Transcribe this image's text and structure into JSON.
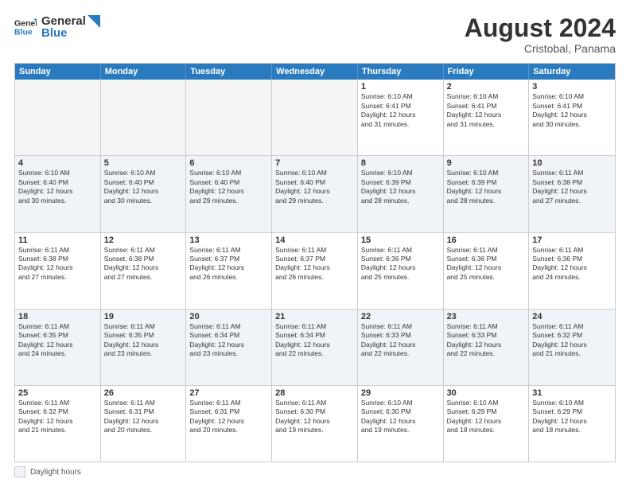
{
  "logo": {
    "general": "General",
    "blue": "Blue"
  },
  "title": "August 2024",
  "subtitle": "Cristobal, Panama",
  "days_of_week": [
    "Sunday",
    "Monday",
    "Tuesday",
    "Wednesday",
    "Thursday",
    "Friday",
    "Saturday"
  ],
  "legend_label": "Daylight hours",
  "weeks": [
    [
      {
        "day": "",
        "info": "",
        "empty": true
      },
      {
        "day": "",
        "info": "",
        "empty": true
      },
      {
        "day": "",
        "info": "",
        "empty": true
      },
      {
        "day": "",
        "info": "",
        "empty": true
      },
      {
        "day": "1",
        "info": "Sunrise: 6:10 AM\nSunset: 6:41 PM\nDaylight: 12 hours\nand 31 minutes.",
        "empty": false
      },
      {
        "day": "2",
        "info": "Sunrise: 6:10 AM\nSunset: 6:41 PM\nDaylight: 12 hours\nand 31 minutes.",
        "empty": false
      },
      {
        "day": "3",
        "info": "Sunrise: 6:10 AM\nSunset: 6:41 PM\nDaylight: 12 hours\nand 30 minutes.",
        "empty": false
      }
    ],
    [
      {
        "day": "4",
        "info": "Sunrise: 6:10 AM\nSunset: 6:40 PM\nDaylight: 12 hours\nand 30 minutes.",
        "empty": false
      },
      {
        "day": "5",
        "info": "Sunrise: 6:10 AM\nSunset: 6:40 PM\nDaylight: 12 hours\nand 30 minutes.",
        "empty": false
      },
      {
        "day": "6",
        "info": "Sunrise: 6:10 AM\nSunset: 6:40 PM\nDaylight: 12 hours\nand 29 minutes.",
        "empty": false
      },
      {
        "day": "7",
        "info": "Sunrise: 6:10 AM\nSunset: 6:40 PM\nDaylight: 12 hours\nand 29 minutes.",
        "empty": false
      },
      {
        "day": "8",
        "info": "Sunrise: 6:10 AM\nSunset: 6:39 PM\nDaylight: 12 hours\nand 28 minutes.",
        "empty": false
      },
      {
        "day": "9",
        "info": "Sunrise: 6:10 AM\nSunset: 6:39 PM\nDaylight: 12 hours\nand 28 minutes.",
        "empty": false
      },
      {
        "day": "10",
        "info": "Sunrise: 6:11 AM\nSunset: 6:38 PM\nDaylight: 12 hours\nand 27 minutes.",
        "empty": false
      }
    ],
    [
      {
        "day": "11",
        "info": "Sunrise: 6:11 AM\nSunset: 6:38 PM\nDaylight: 12 hours\nand 27 minutes.",
        "empty": false
      },
      {
        "day": "12",
        "info": "Sunrise: 6:11 AM\nSunset: 6:38 PM\nDaylight: 12 hours\nand 27 minutes.",
        "empty": false
      },
      {
        "day": "13",
        "info": "Sunrise: 6:11 AM\nSunset: 6:37 PM\nDaylight: 12 hours\nand 26 minutes.",
        "empty": false
      },
      {
        "day": "14",
        "info": "Sunrise: 6:11 AM\nSunset: 6:37 PM\nDaylight: 12 hours\nand 26 minutes.",
        "empty": false
      },
      {
        "day": "15",
        "info": "Sunrise: 6:11 AM\nSunset: 6:36 PM\nDaylight: 12 hours\nand 25 minutes.",
        "empty": false
      },
      {
        "day": "16",
        "info": "Sunrise: 6:11 AM\nSunset: 6:36 PM\nDaylight: 12 hours\nand 25 minutes.",
        "empty": false
      },
      {
        "day": "17",
        "info": "Sunrise: 6:11 AM\nSunset: 6:36 PM\nDaylight: 12 hours\nand 24 minutes.",
        "empty": false
      }
    ],
    [
      {
        "day": "18",
        "info": "Sunrise: 6:11 AM\nSunset: 6:35 PM\nDaylight: 12 hours\nand 24 minutes.",
        "empty": false
      },
      {
        "day": "19",
        "info": "Sunrise: 6:11 AM\nSunset: 6:35 PM\nDaylight: 12 hours\nand 23 minutes.",
        "empty": false
      },
      {
        "day": "20",
        "info": "Sunrise: 6:11 AM\nSunset: 6:34 PM\nDaylight: 12 hours\nand 23 minutes.",
        "empty": false
      },
      {
        "day": "21",
        "info": "Sunrise: 6:11 AM\nSunset: 6:34 PM\nDaylight: 12 hours\nand 22 minutes.",
        "empty": false
      },
      {
        "day": "22",
        "info": "Sunrise: 6:11 AM\nSunset: 6:33 PM\nDaylight: 12 hours\nand 22 minutes.",
        "empty": false
      },
      {
        "day": "23",
        "info": "Sunrise: 6:11 AM\nSunset: 6:33 PM\nDaylight: 12 hours\nand 22 minutes.",
        "empty": false
      },
      {
        "day": "24",
        "info": "Sunrise: 6:11 AM\nSunset: 6:32 PM\nDaylight: 12 hours\nand 21 minutes.",
        "empty": false
      }
    ],
    [
      {
        "day": "25",
        "info": "Sunrise: 6:11 AM\nSunset: 6:32 PM\nDaylight: 12 hours\nand 21 minutes.",
        "empty": false
      },
      {
        "day": "26",
        "info": "Sunrise: 6:11 AM\nSunset: 6:31 PM\nDaylight: 12 hours\nand 20 minutes.",
        "empty": false
      },
      {
        "day": "27",
        "info": "Sunrise: 6:11 AM\nSunset: 6:31 PM\nDaylight: 12 hours\nand 20 minutes.",
        "empty": false
      },
      {
        "day": "28",
        "info": "Sunrise: 6:11 AM\nSunset: 6:30 PM\nDaylight: 12 hours\nand 19 minutes.",
        "empty": false
      },
      {
        "day": "29",
        "info": "Sunrise: 6:10 AM\nSunset: 6:30 PM\nDaylight: 12 hours\nand 19 minutes.",
        "empty": false
      },
      {
        "day": "30",
        "info": "Sunrise: 6:10 AM\nSunset: 6:29 PM\nDaylight: 12 hours\nand 18 minutes.",
        "empty": false
      },
      {
        "day": "31",
        "info": "Sunrise: 6:10 AM\nSunset: 6:29 PM\nDaylight: 12 hours\nand 18 minutes.",
        "empty": false
      }
    ]
  ]
}
